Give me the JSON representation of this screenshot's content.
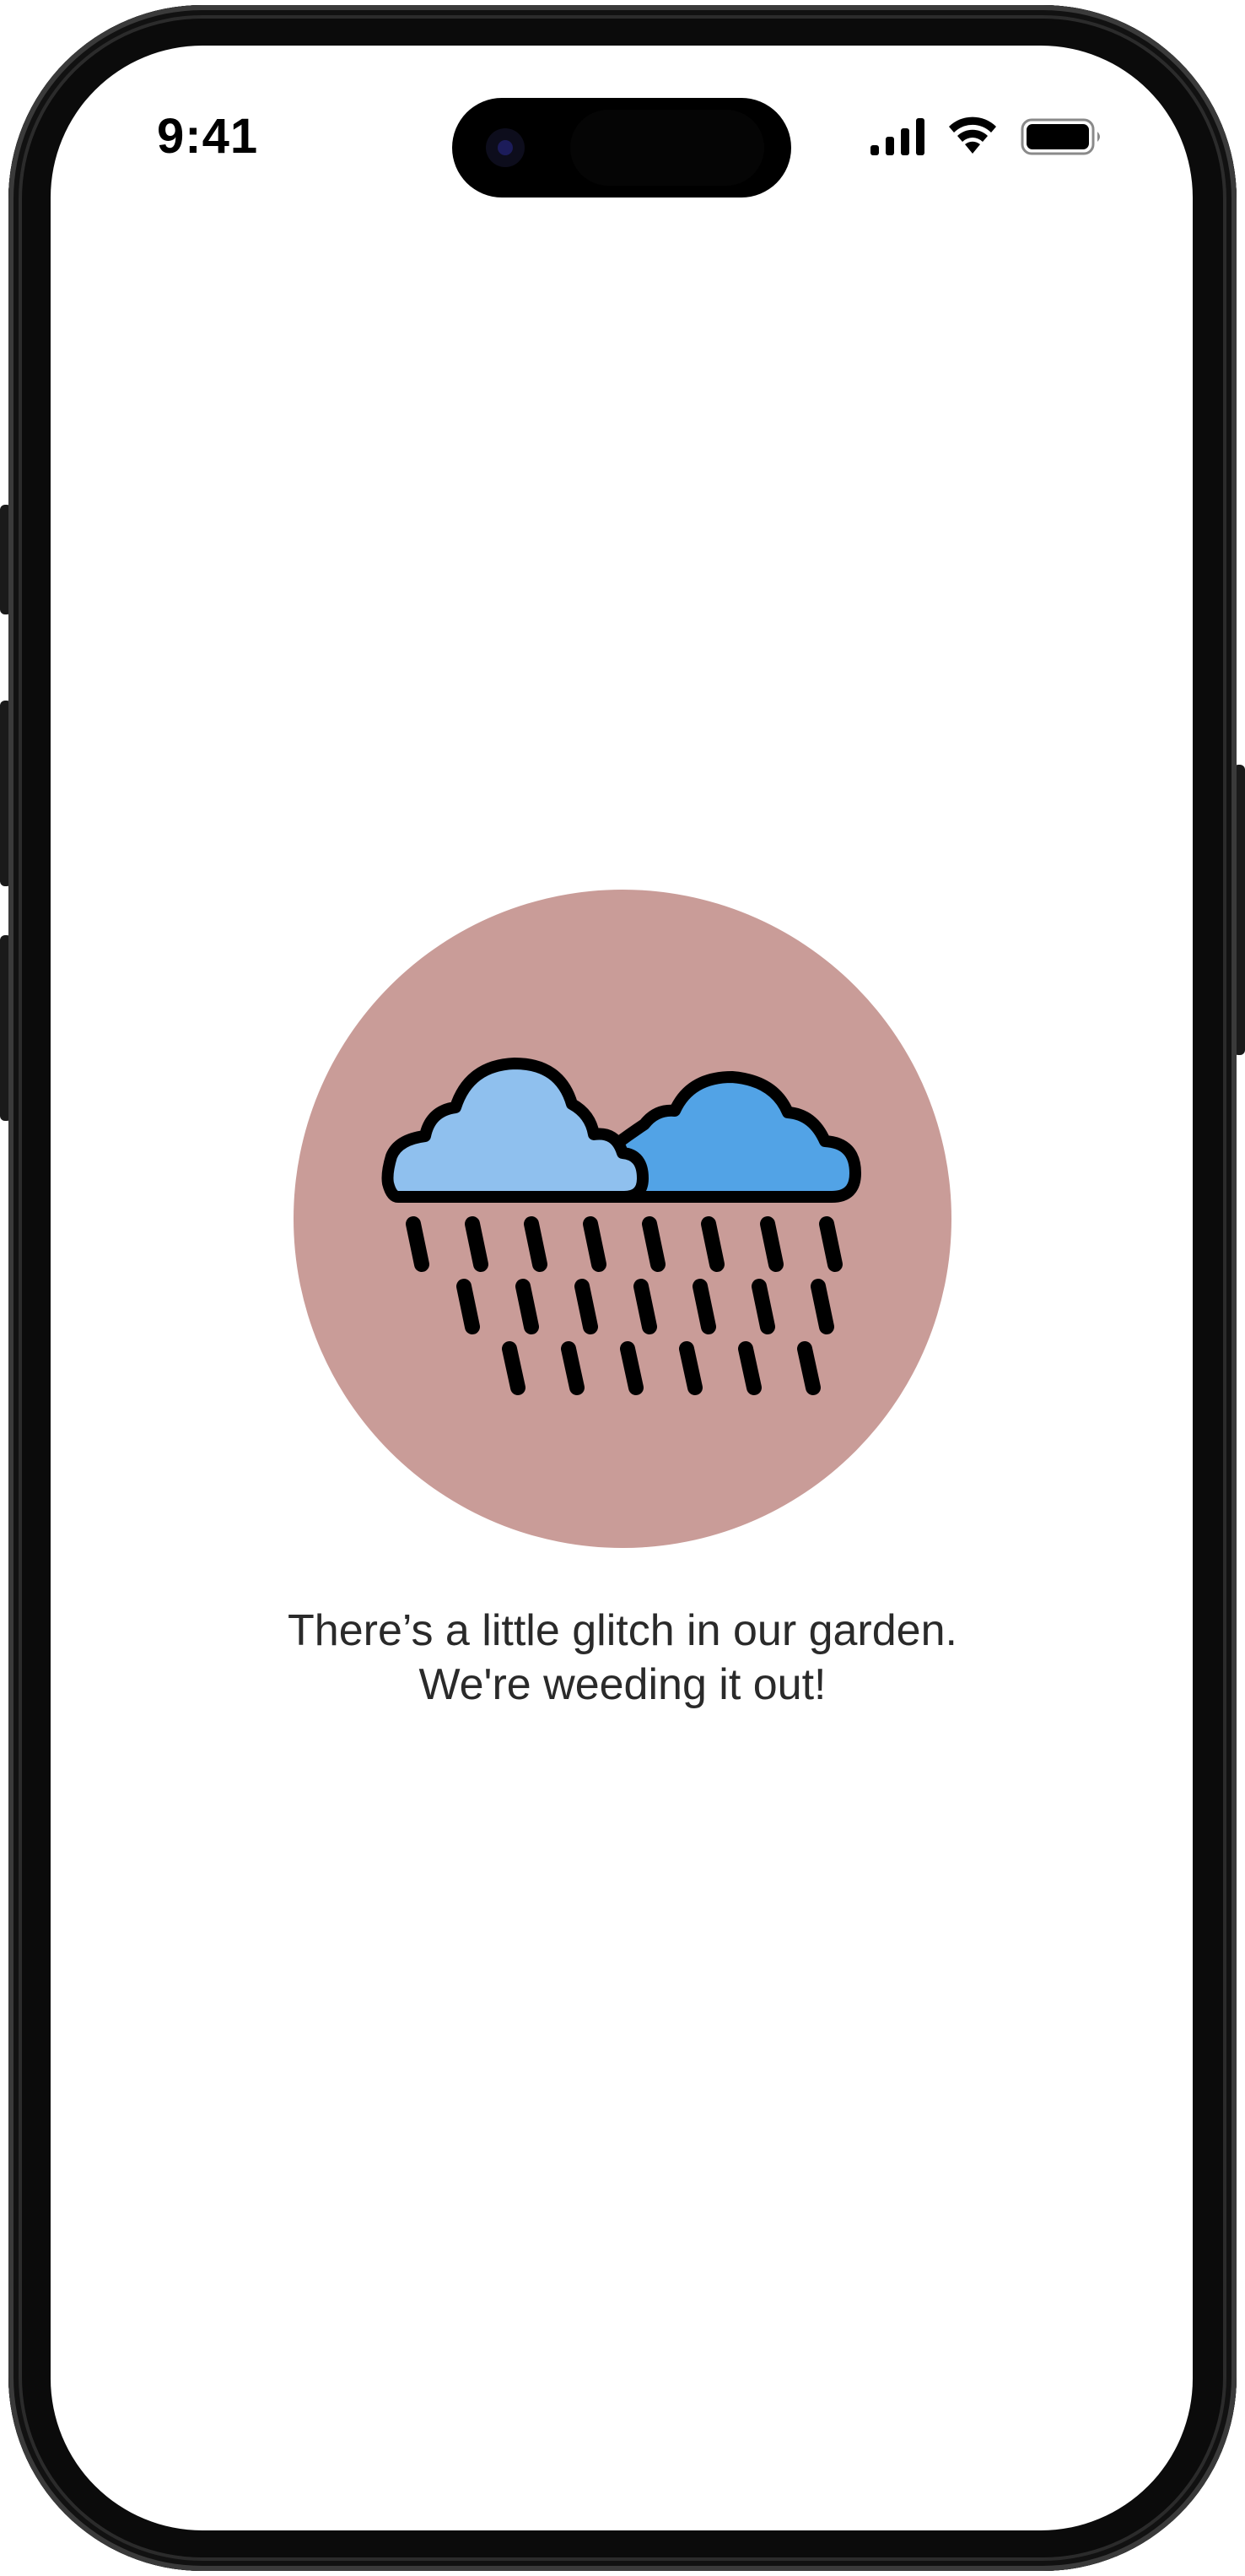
{
  "status_bar": {
    "time": "9:41",
    "icons": [
      "cellular-signal-icon",
      "wifi-icon",
      "battery-icon"
    ]
  },
  "error_screen": {
    "illustration": "rain-clouds-icon",
    "message_line1": "There’s a little glitch in our garden.",
    "message_line2": "We're weeding it out!"
  },
  "colors": {
    "circle_background": "#c99c98",
    "cloud_light": "#8fc0ee",
    "cloud_dark": "#52a3e6",
    "outline": "#000000",
    "text": "#2a2a2a"
  }
}
